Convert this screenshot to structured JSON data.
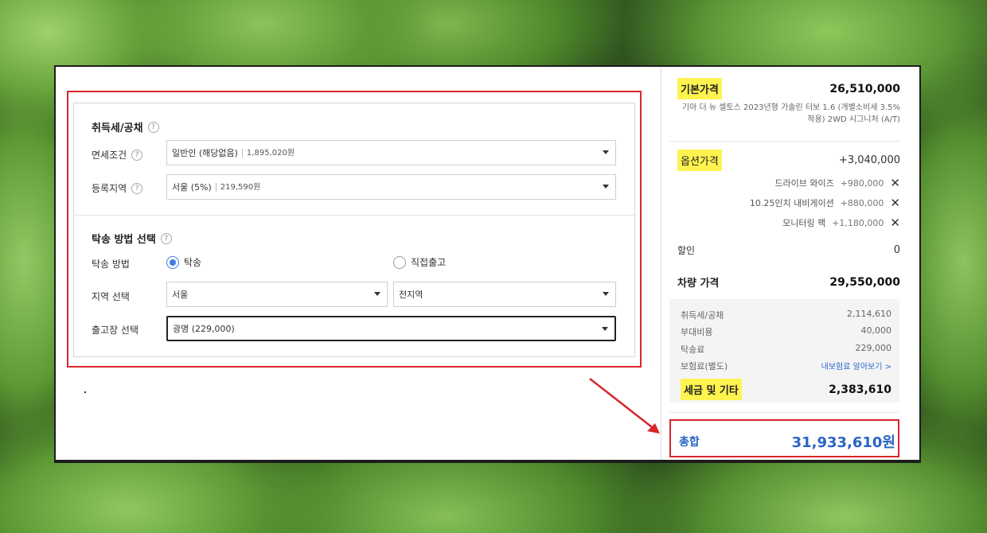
{
  "tax": {
    "title": "취득세/공채",
    "help": "?",
    "exemption_label": "면세조건",
    "exemption_value": "일반인 (해당없음)",
    "exemption_amount": "1,895,020원",
    "region_label": "등록지역",
    "region_value": "서울 (5%)",
    "region_amount": "219,590원"
  },
  "delivery": {
    "title": "탁송 방법 선택",
    "method_label": "탁송 방법",
    "option_delivery": "탁송",
    "option_pickup": "직접출고",
    "selected": "탁송",
    "area_label": "지역 선택",
    "area_value": "서울",
    "area_sub_value": "전지역",
    "center_label": "출고장 선택",
    "center_value": "광명 (229,000)"
  },
  "summary": {
    "base_label": "기본가격",
    "base_price": "26,510,000",
    "model_desc": "기아 더 뉴 셀토스 2023년형 가솔린 터보 1.6 (개별소비세 3.5% 적용) 2WD 시그니처 (A/T)",
    "option_label": "옵션가격",
    "option_price": "+3,040,000",
    "options": [
      {
        "name": "드라이브 와이즈",
        "price": "+980,000"
      },
      {
        "name": "10.25인치 내비게이션",
        "price": "+880,000"
      },
      {
        "name": "모니터링 팩",
        "price": "+1,180,000"
      }
    ],
    "discount_label": "할인",
    "discount_value": "0",
    "car_price_label": "차량 가격",
    "car_price": "29,550,000",
    "fees": [
      {
        "name": "취득세/공채",
        "value": "2,114,610"
      },
      {
        "name": "부대비용",
        "value": "40,000"
      },
      {
        "name": "탁송료",
        "value": "229,000"
      },
      {
        "name": "보험료(별도)",
        "value": "내보험료 알아보기 >"
      }
    ],
    "tax_etc_label": "세금 및 기타",
    "tax_etc_value": "2,383,610",
    "total_label": "총합",
    "total_value": "31,933,610원"
  },
  "colors": {
    "highlight": "#fff44f",
    "accent_blue": "#2864c4",
    "annotation_red": "#d8262d",
    "radio_blue": "#3d7de2"
  }
}
